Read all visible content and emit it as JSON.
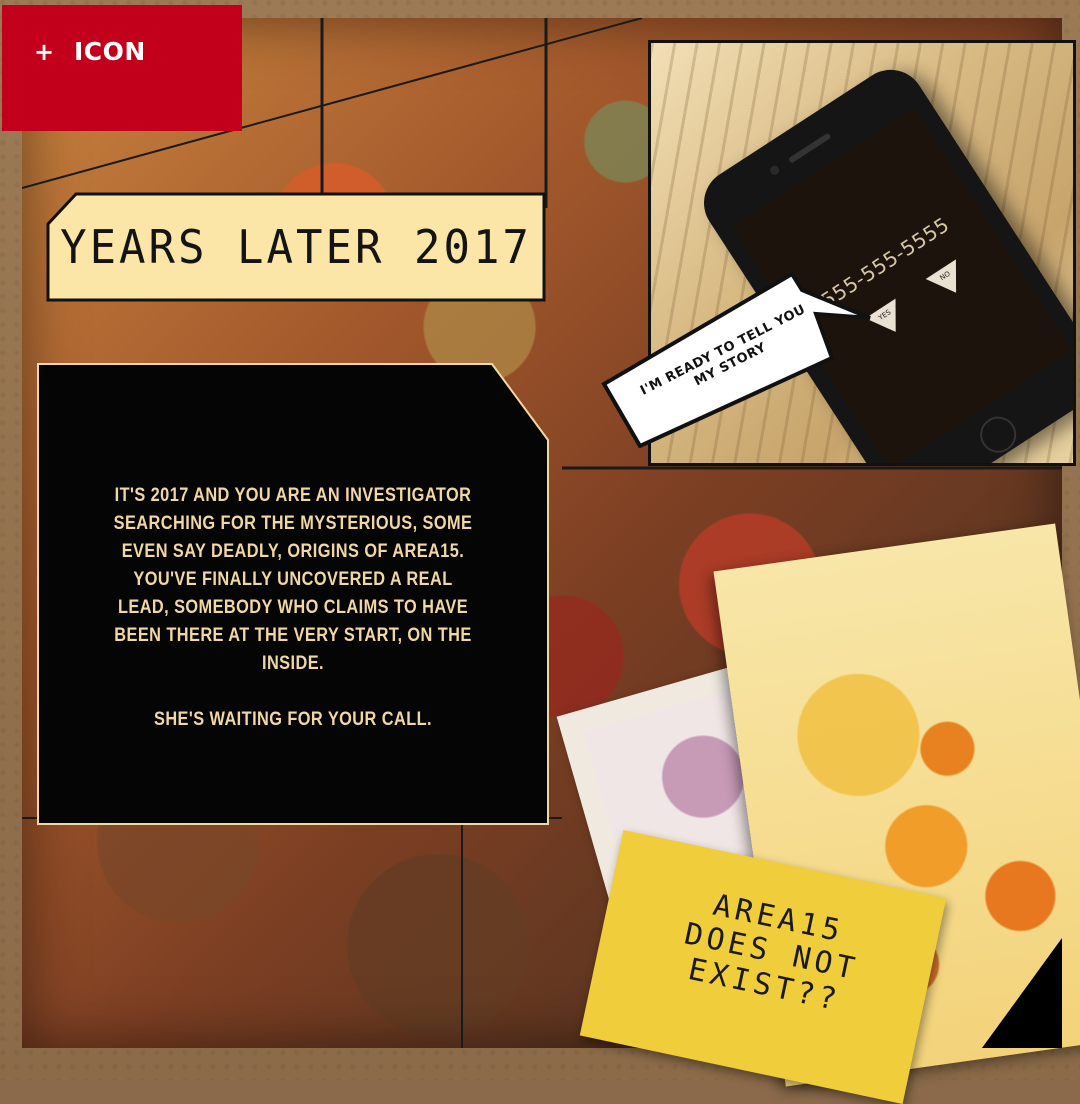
{
  "icon_button": {
    "plus": "+",
    "label": "ICON"
  },
  "title": "YEARS LATER 2017",
  "story": {
    "paragraph1": "IT'S 2017 AND YOU ARE AN INVESTIGATOR SEARCHING FOR THE MYSTERIOUS, SOME EVEN SAY DEADLY, ORIGINS OF AREA15. YOU'VE FINALLY UNCOVERED A REAL LEAD, SOMEBODY WHO CLAIMS TO HAVE BEEN THERE AT THE VERY START, ON THE INSIDE.",
    "paragraph2": "SHE'S WAITING FOR YOUR CALL."
  },
  "phone": {
    "number": "555-555-5555",
    "yes_label": "YES",
    "no_label": "NO"
  },
  "speech_bubble": "I'M READY TO TELL YOU MY STORY",
  "note": {
    "line1": "AREA15",
    "line2": "DOES NOT",
    "line3": "EXIST??"
  },
  "colors": {
    "accent_red": "#c2001b",
    "title_bg": "#fbe6a8",
    "story_text": "#f1d7a3",
    "note_yellow": "#f0cd3a"
  },
  "icons": [
    "plus-icon",
    "phone-icon",
    "yes-icon",
    "no-icon"
  ]
}
